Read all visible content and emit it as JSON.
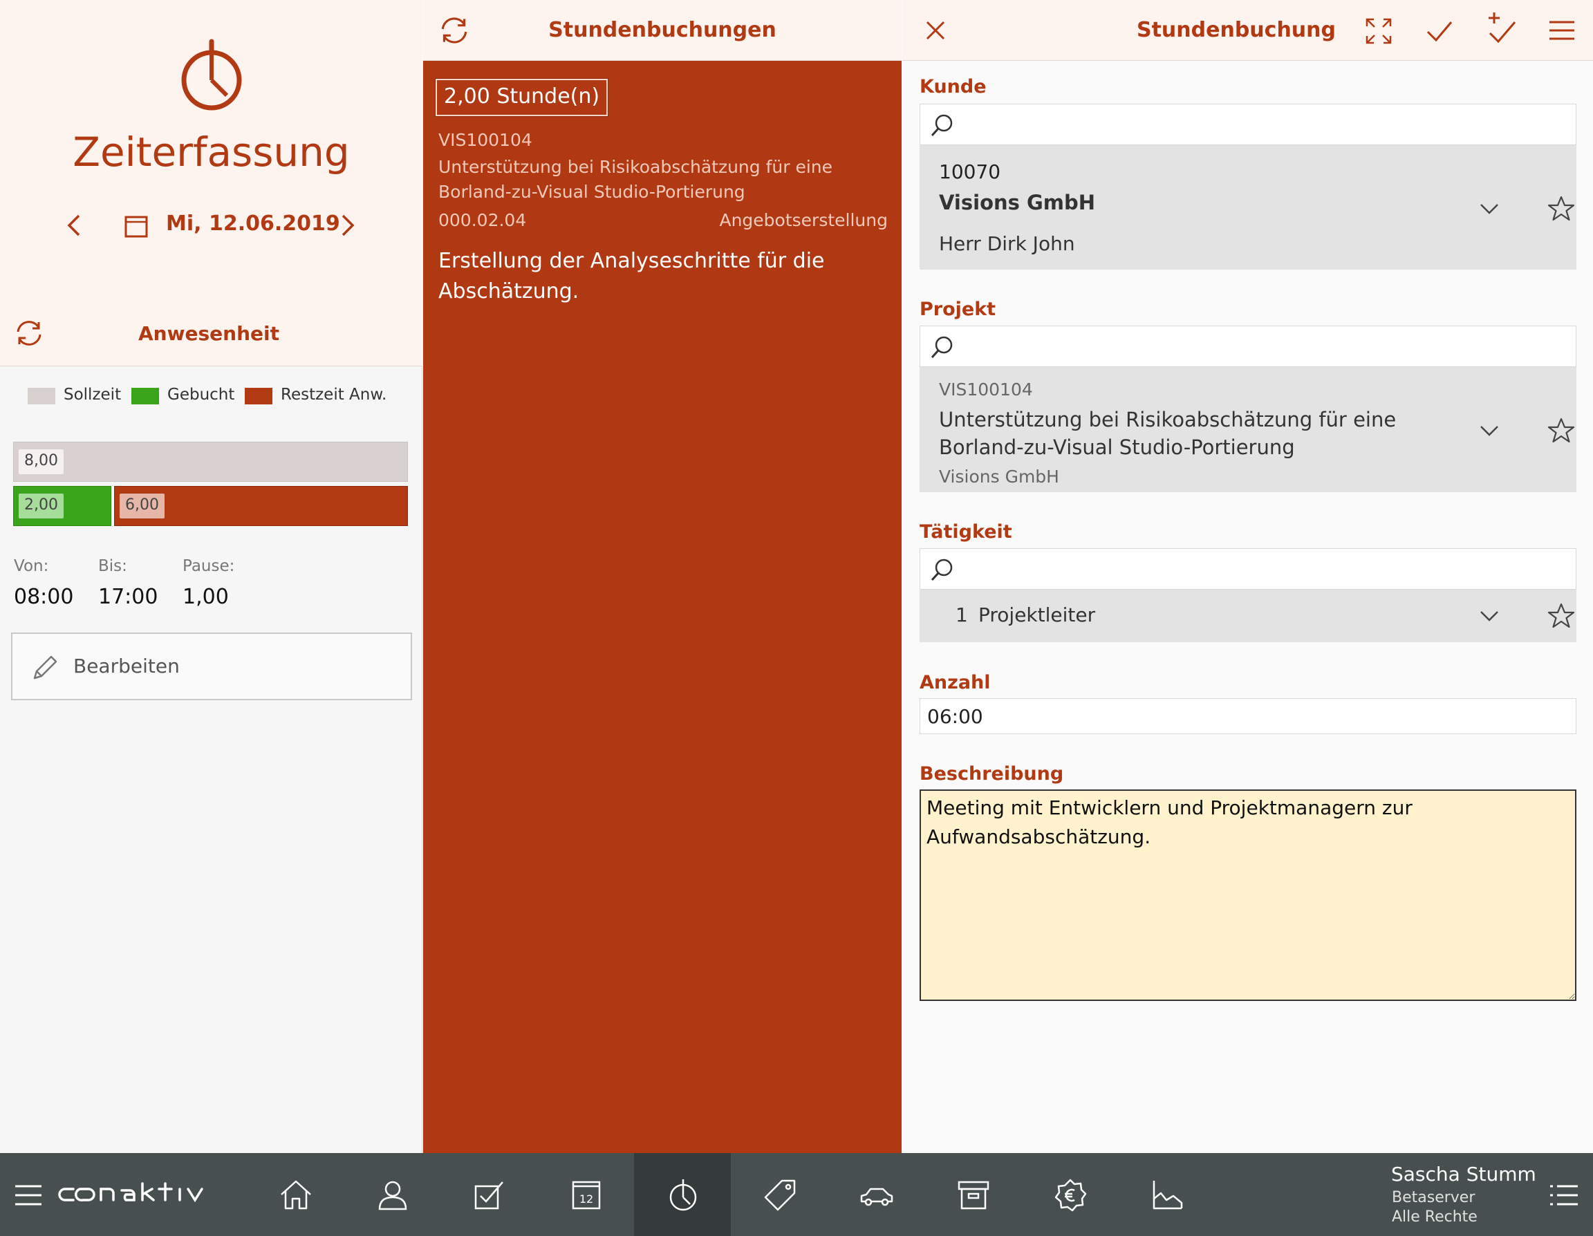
{
  "left_panel": {
    "app_title": "Zeiterfassung",
    "date": "Mi, 12.06.2019",
    "attendance_title": "Anwesenheit",
    "legend": [
      {
        "label": "Sollzeit",
        "color": "#d8d1cf"
      },
      {
        "label": "Gebucht",
        "color": "#3aa51a"
      },
      {
        "label": "Restzeit Anw.",
        "color": "#b23a12"
      }
    ],
    "bars": {
      "target": "8,00",
      "booked": "2,00",
      "remaining": "6,00",
      "booked_fraction": 0.25
    },
    "times": {
      "from_label": "Von:",
      "from_value": "08:00",
      "to_label": "Bis:",
      "to_value": "17:00",
      "break_label": "Pause:",
      "break_value": "1,00"
    },
    "edit_label": "Bearbeiten"
  },
  "middle_panel": {
    "title": "Stundenbuchungen",
    "entry": {
      "hours": "2,00 Stunde(n)",
      "project_code": "VIS100104",
      "project_description": "Unterstützung bei Risikoabschätzung für eine Borland-zu-Visual Studio-Portierung",
      "phase_code": "000.02.04",
      "phase_name": "Angebotserstellung",
      "description": "Erstellung der Analyseschritte für die Abschätzung."
    }
  },
  "right_panel": {
    "title": "Stundenbuchung",
    "customer": {
      "label": "Kunde",
      "search_placeholder": "",
      "number": "10070",
      "name": "Visions GmbH",
      "contact": "Herr Dirk John"
    },
    "project": {
      "label": "Projekt",
      "search_placeholder": "",
      "code": "VIS100104",
      "description": "Unterstützung bei Risikoabschätzung für eine Borland-zu-Visual Studio-Portierung",
      "customer": "Visions GmbH"
    },
    "activity": {
      "label": "Tätigkeit",
      "search_placeholder": "",
      "number": "1",
      "name": "Projektleiter"
    },
    "amount": {
      "label": "Anzahl",
      "value": "06:00"
    },
    "description": {
      "label": "Beschreibung",
      "value": "Meeting mit Entwicklern und Projektmanagern zur Aufwandsabschätzung."
    }
  },
  "bottom_bar": {
    "brand": "conaktiv",
    "nav_icons": [
      "home-icon",
      "contacts-icon",
      "tasks-icon",
      "calendar-icon",
      "time-tracking-icon",
      "tag-icon",
      "car-icon",
      "archive-icon",
      "settings-euro-icon",
      "chart-icon"
    ],
    "active_nav": "time-tracking-icon",
    "calendar_day": "12",
    "user": {
      "name": "Sascha Stumm",
      "server": "Betaserver",
      "rights": "Alle Rechte"
    }
  },
  "colors": {
    "accent": "#b23a12",
    "header_bg": "#fdf3ef",
    "bottom_bar": "#47504f",
    "booked_green": "#3aa51a",
    "textarea_bg": "#fff2cc"
  }
}
